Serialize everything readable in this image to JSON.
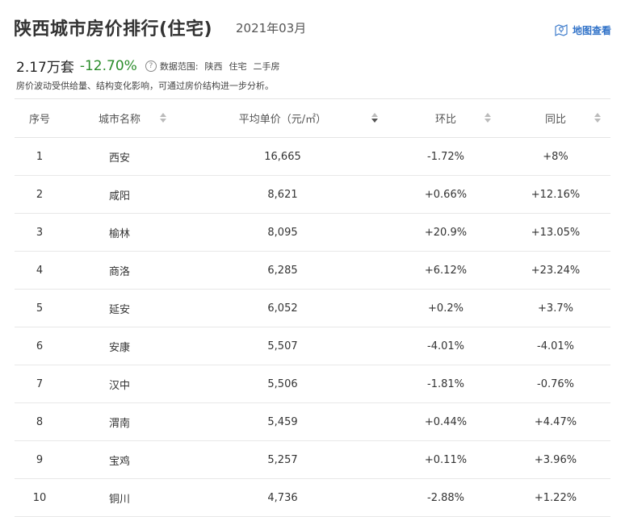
{
  "header": {
    "title": "陕西城市房价排行(住宅)",
    "date": "2021年03月",
    "map_link_label": "地图查看"
  },
  "summary": {
    "avg_price": "2.17万套",
    "change": "-12.70%",
    "scope_label": "数据范围:",
    "scope_region": "陕西",
    "scope_type": "住宅",
    "scope_market": "二手房",
    "description": "房价波动受供给量、结构变化影响，可通过房价结构进一步分析。"
  },
  "table": {
    "columns": [
      "序号",
      "城市名称",
      "平均单价（元/㎡）",
      "环比",
      "同比"
    ],
    "rows": [
      {
        "rank": "1",
        "city": "西安",
        "price": "16,665",
        "mom": "-1.72%",
        "yoy": "+8%"
      },
      {
        "rank": "2",
        "city": "咸阳",
        "price": "8,621",
        "mom": "+0.66%",
        "yoy": "+12.16%"
      },
      {
        "rank": "3",
        "city": "榆林",
        "price": "8,095",
        "mom": "+20.9%",
        "yoy": "+13.05%"
      },
      {
        "rank": "4",
        "city": "商洛",
        "price": "6,285",
        "mom": "+6.12%",
        "yoy": "+23.24%"
      },
      {
        "rank": "5",
        "city": "延安",
        "price": "6,052",
        "mom": "+0.2%",
        "yoy": "+3.7%"
      },
      {
        "rank": "6",
        "city": "安康",
        "price": "5,507",
        "mom": "-4.01%",
        "yoy": "-4.01%"
      },
      {
        "rank": "7",
        "city": "汉中",
        "price": "5,506",
        "mom": "-1.81%",
        "yoy": "-0.76%"
      },
      {
        "rank": "8",
        "city": "渭南",
        "price": "5,459",
        "mom": "+0.44%",
        "yoy": "+4.47%"
      },
      {
        "rank": "9",
        "city": "宝鸡",
        "price": "5,257",
        "mom": "+0.11%",
        "yoy": "+3.96%"
      },
      {
        "rank": "10",
        "city": "铜川",
        "price": "4,736",
        "mom": "-2.88%",
        "yoy": "+1.22%"
      }
    ]
  },
  "colors": {
    "increase": "#d0021b",
    "decrease": "#2a8c2a",
    "link": "#3072c8"
  }
}
